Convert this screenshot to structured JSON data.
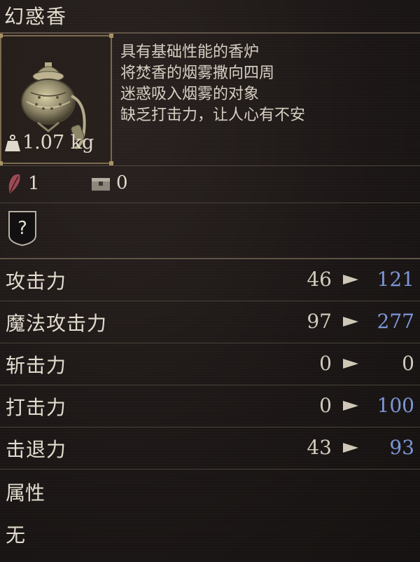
{
  "item": {
    "name": "幻惑香",
    "weight": "1.07 kg",
    "description": [
      "具有基础性能的香炉",
      "将焚香的烟雾撒向四周",
      "迷惑吸入烟雾的对象",
      "缺乏打击力，让人心有不安"
    ],
    "icon": "censer-icon"
  },
  "requirements": {
    "stat_icon": "strength-feather-icon",
    "stat_value": "1",
    "chest_icon": "chest-icon",
    "chest_value": "0"
  },
  "affinity_badge": {
    "icon": "question-mark-shield-icon",
    "symbol": "?"
  },
  "stats": [
    {
      "label": "攻击力",
      "current": "46",
      "new": "121",
      "new_color": "#7d96d6"
    },
    {
      "label": "魔法攻击力",
      "current": "97",
      "new": "277",
      "new_color": "#7d96d6"
    },
    {
      "label": "斩击力",
      "current": "0",
      "new": "0",
      "new_color": "#d2cabb"
    },
    {
      "label": "打击力",
      "current": "0",
      "new": "100",
      "new_color": "#7d96d6"
    },
    {
      "label": "击退力",
      "current": "43",
      "new": "93",
      "new_color": "#7d96d6"
    }
  ],
  "attribute": {
    "label": "属性",
    "value": "无"
  }
}
